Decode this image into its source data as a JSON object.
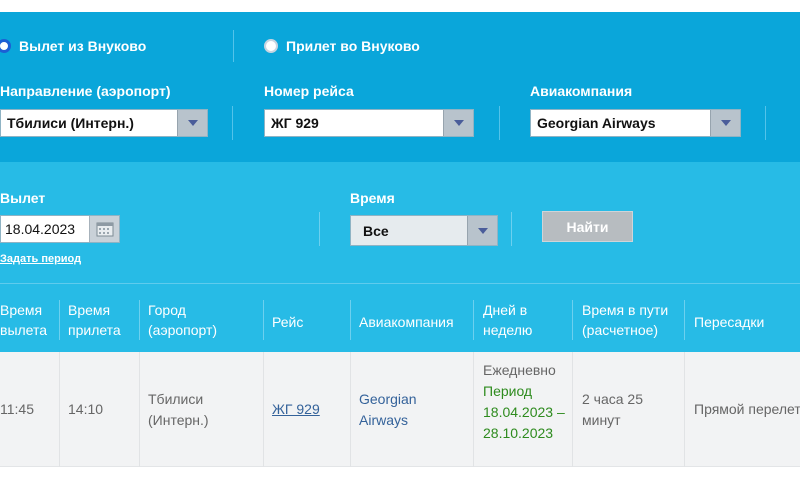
{
  "direction_radios": [
    {
      "label": "Вылет из Внуково",
      "selected": true
    },
    {
      "label": "Прилет во Внуково",
      "selected": false
    }
  ],
  "filters": {
    "airport_label": "Направление (аэропорт)",
    "airport_value": "Тбилиси (Интерн.)",
    "flight_label": "Номер рейса",
    "flight_value": "ЖГ 929",
    "airline_label": "Авиакомпания",
    "airline_value": "Georgian Airways",
    "departure_label": "Вылет",
    "departure_date": "18.04.2023",
    "set_period": "Задать период",
    "time_label": "Время",
    "time_value": "Все",
    "search_button": "Найти"
  },
  "table": {
    "headers": [
      "Время вылета",
      "Время прилета",
      "Город (аэропорт)",
      "Рейс",
      "Авиакомпания",
      "Дней в неделю",
      "Время в пути (расчетное)",
      "Пересадки"
    ],
    "rows": [
      {
        "departure": "11:45",
        "arrival": "14:10",
        "city": "Тбилиси (Интерн.)",
        "flight": "ЖГ 929",
        "airline": "Georgian Airways",
        "days": "Ежедневно",
        "period": "Период 18.04.2023 – 28.10.2023",
        "duration": "2 часа 25 минут",
        "transfers": "Прямой перелет"
      }
    ]
  },
  "colors": {
    "panel_top": "#0aa6da",
    "panel_bottom": "#27bbe6",
    "link_blue": "#34629a",
    "period_green": "#2e8b1e"
  }
}
